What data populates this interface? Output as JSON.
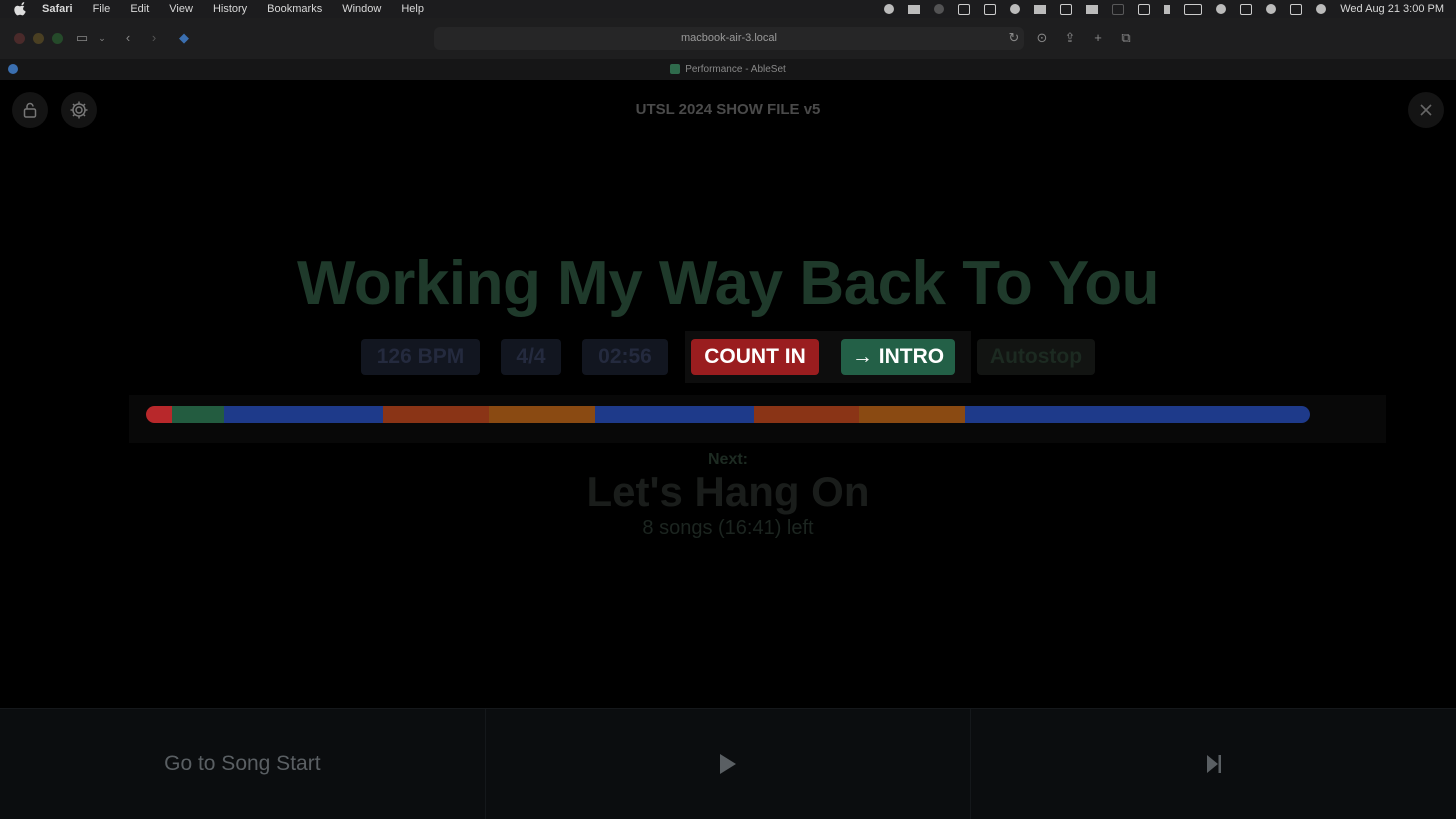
{
  "menubar": {
    "app_name": "Safari",
    "items": [
      "File",
      "Edit",
      "View",
      "History",
      "Bookmarks",
      "Window",
      "Help"
    ],
    "datetime": "Wed Aug 21  3:00 PM"
  },
  "browser": {
    "url": "macbook-air-3.local",
    "tab_title": "Performance - AbleSet"
  },
  "app": {
    "show_file": "UTSL 2024 SHOW FILE v5",
    "song_title": "Working My Way Back To You",
    "bpm": "126 BPM",
    "time_signature": "4/4",
    "duration": "02:56",
    "count_in_label": "COUNT IN",
    "section_arrow": "→",
    "section_label": "INTRO",
    "autostop_label": "Autostop",
    "next_label": "Next:",
    "next_song": "Let's Hang On",
    "remaining": "8 songs (16:41) left"
  },
  "progress": {
    "segments": [
      {
        "fraction": 0.022,
        "color": "#b8282b"
      },
      {
        "fraction": 0.045,
        "color": "#235c40"
      },
      {
        "fraction": 0.137,
        "color": "#1e3a8a"
      },
      {
        "fraction": 0.091,
        "color": "#8a3416"
      },
      {
        "fraction": 0.091,
        "color": "#8a4a12"
      },
      {
        "fraction": 0.136,
        "color": "#1e3a8a"
      },
      {
        "fraction": 0.091,
        "color": "#8a3416"
      },
      {
        "fraction": 0.091,
        "color": "#8a4a12"
      },
      {
        "fraction": 0.296,
        "color": "#1e3a8a"
      }
    ]
  },
  "bottom_bar": {
    "go_to_start": "Go to Song Start"
  },
  "icons": {
    "lock": "unlock-icon",
    "settings": "gear-icon",
    "close": "close-icon",
    "play": "play-icon",
    "skip": "skip-next-icon"
  }
}
